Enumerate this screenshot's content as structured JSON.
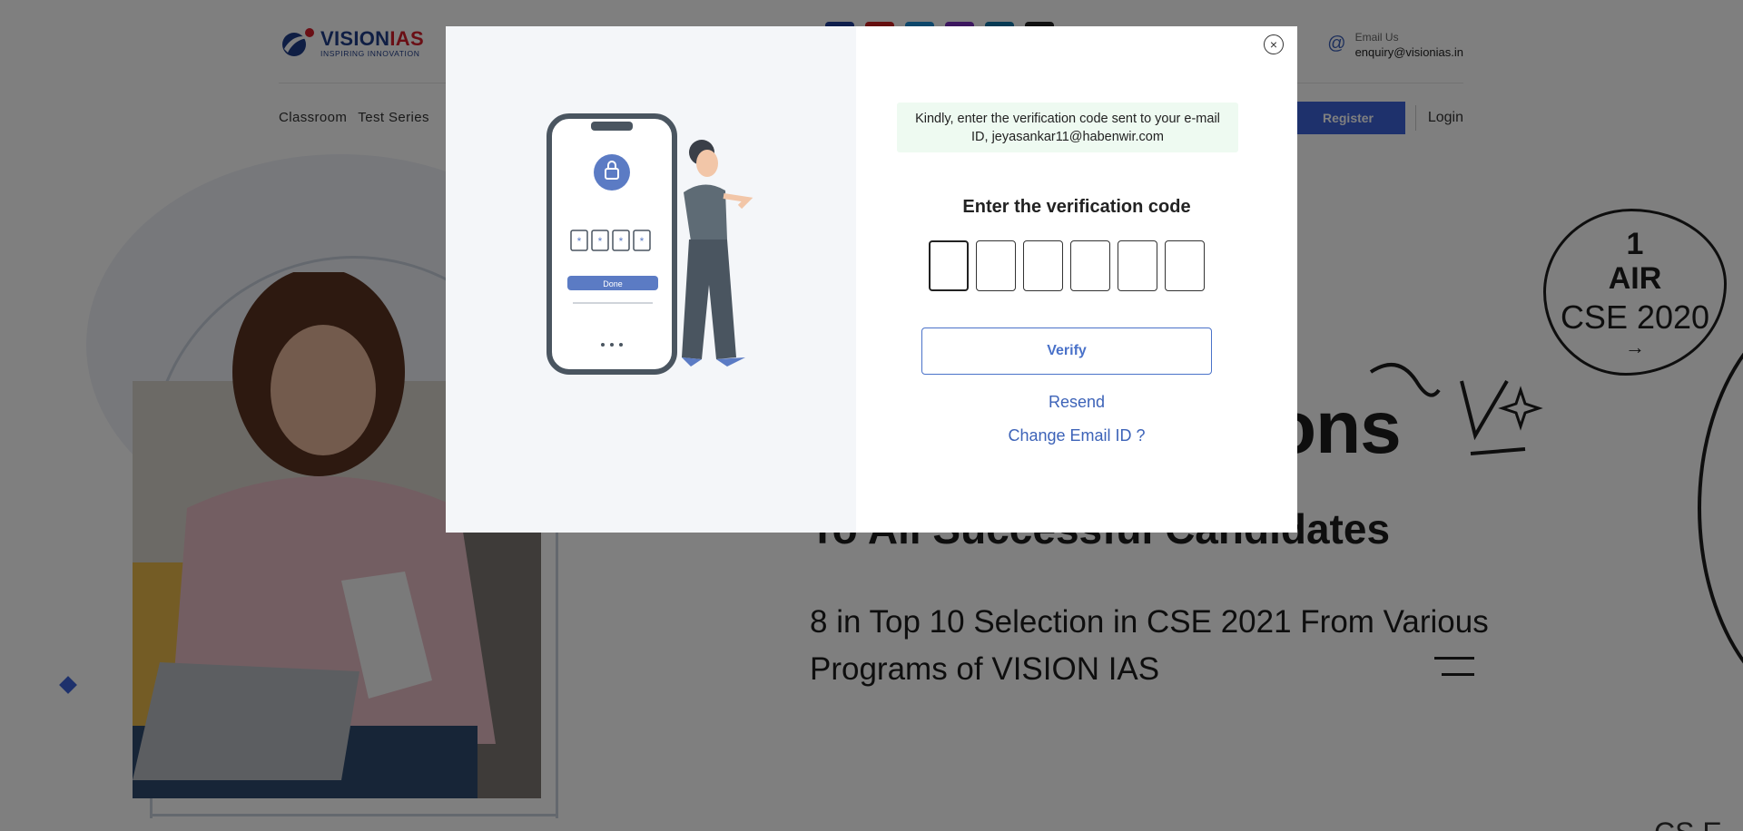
{
  "header": {
    "logo": {
      "brand_part1": "VISION",
      "brand_part2": "IAS",
      "tagline": "INSPIRING INNOVATION"
    },
    "email": {
      "label": "Email Us",
      "value": "enquiry@visionias.in"
    },
    "socials": [
      {
        "icon": "facebook-icon",
        "color": "#1f3f9a"
      },
      {
        "icon": "youtube-icon",
        "color": "#cc1f1f"
      },
      {
        "icon": "twitter-icon",
        "color": "#1a8fd6"
      },
      {
        "icon": "instagram-icon",
        "color": "#7b2fbf"
      },
      {
        "icon": "linkedin-icon",
        "color": "#0e76a8"
      },
      {
        "icon": "telegram-icon",
        "color": "#222222"
      }
    ]
  },
  "nav": {
    "items": [
      "Classroom",
      "Test Series"
    ],
    "register_label": "Register",
    "login_label": "Login"
  },
  "hero": {
    "big_word": "ons",
    "sub_heading": "To All Successful Candidates",
    "text": "8 in Top 10 Selection in CSE 2021 From Various Programs of VISION IAS",
    "badge": {
      "line1": "1",
      "line2": "AIR",
      "line3": "CSE 2020",
      "arrow": "→"
    },
    "bottom_peek": "CS E"
  },
  "modal": {
    "close_icon": "×",
    "notice": "Kindly, enter the verification code sent to your e-mail ID, jeyasankar11@habenwir.com",
    "title": "Enter the verification code",
    "otp_digits": [
      "",
      "",
      "",
      "",
      "",
      ""
    ],
    "verify_label": "Verify",
    "resend_label": "Resend",
    "change_email_label": "Change Email ID ?",
    "illustration": {
      "phone_button_label": "Done",
      "code_boxes": [
        "*",
        "*",
        "*",
        "*"
      ]
    }
  },
  "colors": {
    "accent": "#3d63d8",
    "link": "#3d63b8",
    "notice_bg": "#eefaf1",
    "overlay": "rgba(0,0,0,0.5)"
  }
}
